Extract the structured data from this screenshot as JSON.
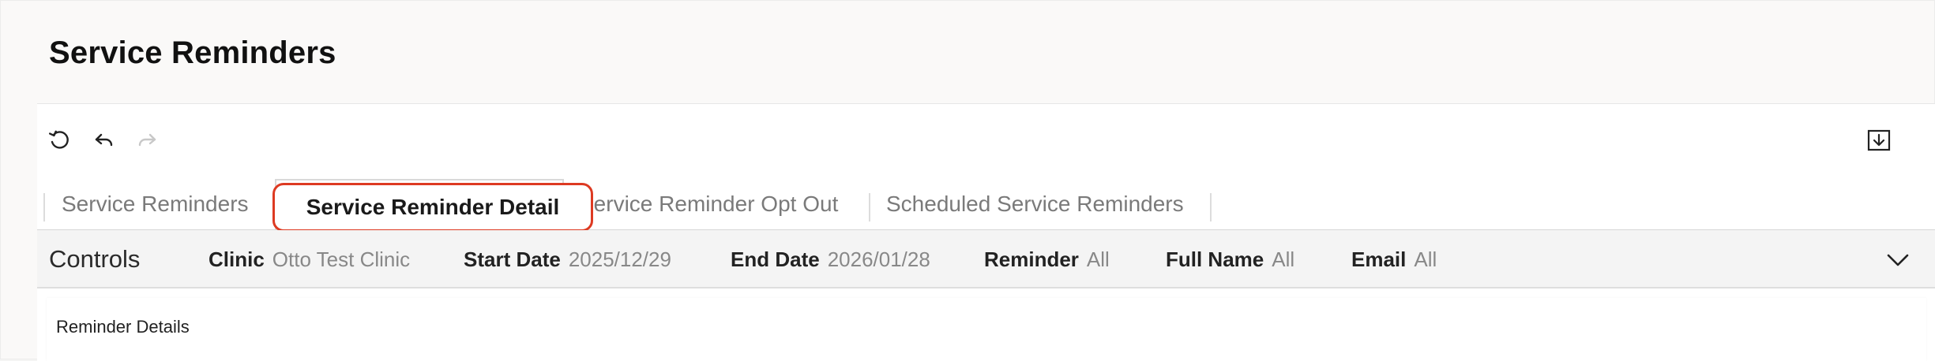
{
  "page": {
    "title": "Service Reminders"
  },
  "toolbar": {
    "refresh_icon": "refresh-icon",
    "undo_icon": "undo-icon",
    "redo_icon": "redo-icon",
    "download_icon": "download-icon"
  },
  "tabs": [
    {
      "label": "Service Reminders",
      "active": false
    },
    {
      "label": "Service Reminder Detail",
      "active": true
    },
    {
      "label": "Service Reminder Opt Out",
      "active": false
    },
    {
      "label": "Scheduled Service Reminders",
      "active": false
    }
  ],
  "controls": {
    "label": "Controls",
    "filters": [
      {
        "key": "Clinic",
        "value": "Otto Test Clinic"
      },
      {
        "key": "Start Date",
        "value": "2025/12/29"
      },
      {
        "key": "End Date",
        "value": "2026/01/28"
      },
      {
        "key": "Reminder",
        "value": "All"
      },
      {
        "key": "Full Name",
        "value": "All"
      },
      {
        "key": "Email",
        "value": "All"
      }
    ]
  },
  "details": {
    "title": "Reminder Details"
  },
  "colors": {
    "highlight": "#dd3a22",
    "controls_bg": "#f4f4f4"
  }
}
